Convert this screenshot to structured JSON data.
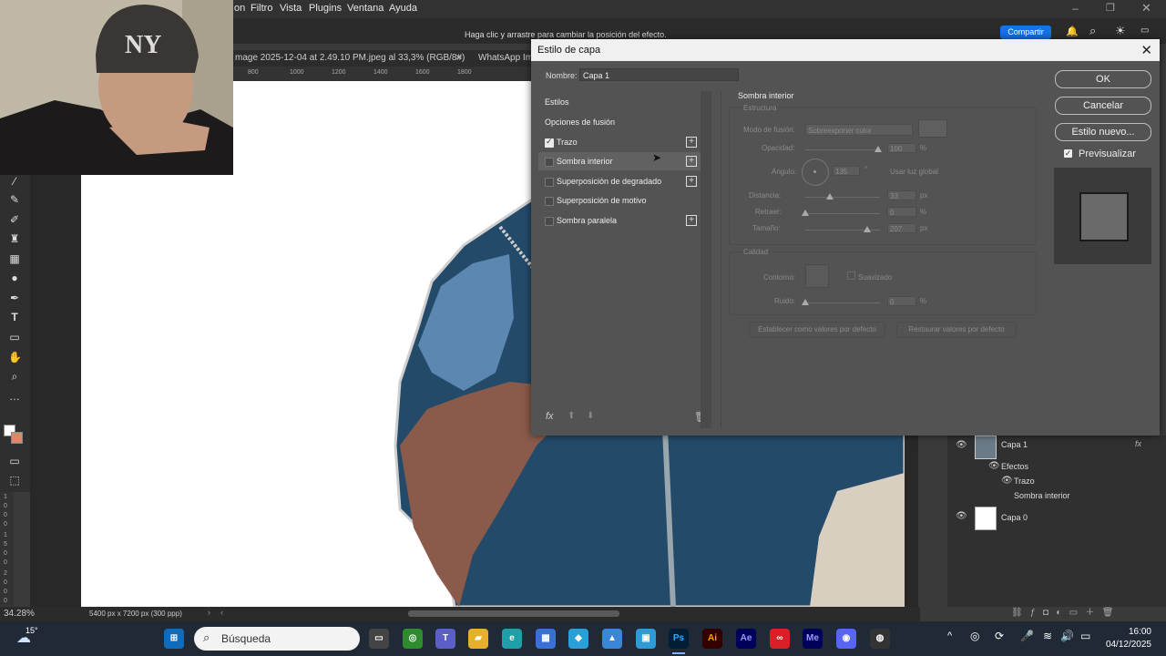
{
  "app": {
    "menu": [
      "on",
      "Filtro",
      "Vista",
      "Plugins",
      "Ventana",
      "Ayuda"
    ],
    "options_hint": "Haga clic y arrastre para cambiar la posición del efecto.",
    "share_label": "Compartir",
    "doc_tabs": [
      "mage 2025-12-04 at 2.49.10 PM.jpeg al 33,3% (RGB/8#)",
      "WhatsApp Im"
    ],
    "ruler_ticks": [
      "800",
      "1000",
      "1200",
      "1400",
      "1600",
      "1800"
    ],
    "vruler_ticks": [
      "1",
      "0",
      "0",
      "0",
      "1",
      "5",
      "0",
      "0",
      "2",
      "0",
      "0",
      "0"
    ],
    "status": {
      "zoom": "34.28%",
      "doc_size": "5400 px x 7200 px (300 ppp)"
    }
  },
  "dialog": {
    "title": "Estilo de capa",
    "name_label": "Nombre:",
    "name_value": "Capa 1",
    "styles_header": "Estilos",
    "blend_options": "Opciones de fusión",
    "styles": [
      {
        "label": "Trazo",
        "checked": true,
        "plus": true
      },
      {
        "label": "Sombra interior",
        "checked": false,
        "plus": true
      },
      {
        "label": "Superposición de degradado",
        "checked": false,
        "plus": true
      },
      {
        "label": "Superposición de motivo",
        "checked": false,
        "plus": false
      },
      {
        "label": "Sombra paralela",
        "checked": false,
        "plus": true
      }
    ],
    "fx_label": "fx",
    "section_title": "Sombra interior",
    "structure": {
      "title": "Estructura",
      "blend_mode_label": "Modo de fusión:",
      "blend_mode_value": "Sobreexponer color",
      "opacity_label": "Opacidad:",
      "opacity_value": "100",
      "angle_label": "Ángulo:",
      "angle_value": "135",
      "global_light": "Usar luz global",
      "distance_label": "Distancia:",
      "distance_value": "33",
      "choke_label": "Retraer:",
      "choke_value": "0",
      "size_label": "Tamaño:",
      "size_value": "207",
      "unit_pct": "%",
      "unit_px": "px",
      "unit_deg": "°"
    },
    "quality": {
      "title": "Calidad",
      "contour_label": "Contorno:",
      "antialiased": "Suavizado",
      "noise_label": "Ruido:",
      "noise_value": "0"
    },
    "make_default": "Establecer como valores por defecto",
    "reset_default": "Restaurar valores por defecto",
    "ok": "OK",
    "cancel": "Cancelar",
    "new_style": "Estilo nuevo...",
    "preview_label": "Previsualizar",
    "preview_checked": true
  },
  "layers": {
    "rows": [
      {
        "name": "Capa 1"
      },
      {
        "name": "Efectos"
      },
      {
        "name": "Trazo"
      },
      {
        "name": "Sombra interior"
      },
      {
        "name": "Capa 0"
      }
    ],
    "fx": "fx"
  },
  "taskbar": {
    "weather": "15°",
    "search_placeholder": "Búsqueda",
    "icons": [
      "windows-start",
      "task-view",
      "xbox",
      "teams",
      "file-explorer",
      "edge",
      "store",
      "copilot",
      "photos",
      "paint",
      "photoshop",
      "illustrator",
      "after-effects",
      "creative-cloud",
      "media-encoder",
      "discord",
      "obs"
    ],
    "icon_labels": {
      "photoshop": "Ps",
      "illustrator": "Ai",
      "after-effects": "Ae",
      "media-encoder": "Me"
    },
    "time": "16:00",
    "date": "04/12/2025"
  }
}
